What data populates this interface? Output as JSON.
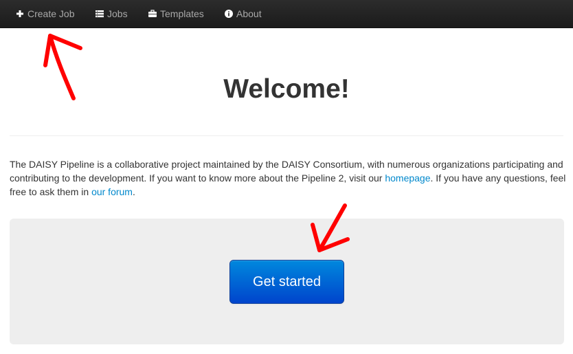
{
  "navbar": {
    "items": [
      {
        "label": "Create Job",
        "icon": "plus-icon"
      },
      {
        "label": "Jobs",
        "icon": "list-icon"
      },
      {
        "label": "Templates",
        "icon": "briefcase-icon"
      },
      {
        "label": "About",
        "icon": "info-icon"
      }
    ]
  },
  "main": {
    "title": "Welcome!",
    "intro": {
      "text_before_homepage": "The DAISY Pipeline is a collaborative project maintained by the DAISY Consortium, with numerous organizations participating and contributing to the development. If you want to know more about the Pipeline 2, visit our ",
      "homepage_link": "homepage",
      "text_before_forum": ". If you have any questions, feel free to ask them in ",
      "forum_link": "our forum",
      "text_end": "."
    },
    "cta_label": "Get started"
  },
  "colors": {
    "navbar_bg": "#1b1b1b",
    "nav_text": "#a9a9a9",
    "link": "#0088cc",
    "cta_top": "#0088dd",
    "cta_bottom": "#0044cc",
    "hero_bg": "#eeeeee",
    "annotation_arrow": "#ff0000"
  }
}
